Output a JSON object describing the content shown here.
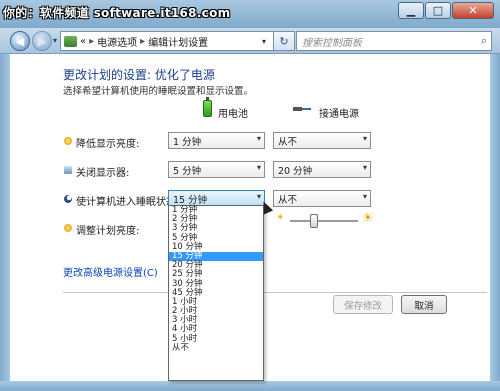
{
  "window": {
    "watermark": "你的：软件频道 software.it168.com",
    "minimize": "▁",
    "maximize": "□",
    "close": "✕"
  },
  "nav": {
    "back_glyph": "◀",
    "forward_glyph": "▶",
    "dropdown_glyph": "▾",
    "address_prefix": "«",
    "breadcrumb": [
      "电源选项",
      "编辑计划设置"
    ],
    "breadcrumb_sep": "▸",
    "refresh_glyph": "↻",
    "search_placeholder": "搜索控制面板",
    "search_glyph": "⌕"
  },
  "page": {
    "title": "更改计划的设置: 优化了电源",
    "subtitle": "选择希望计算机使用的睡眠设置和显示设置。",
    "columns": {
      "battery": "用电池",
      "plugged": "接通电源"
    },
    "rows": [
      {
        "label": "降低显示亮度:",
        "battery": "1 分钟",
        "plugged": "从不"
      },
      {
        "label": "关闭显示器:",
        "battery": "5 分钟",
        "plugged": "20 分钟"
      },
      {
        "label": "使计算机进入睡眠状态:",
        "battery": "15 分钟",
        "plugged": "从不"
      },
      {
        "label": "调整计划亮度:"
      }
    ],
    "brightness": {
      "battery_level": 0.5,
      "plugged_level": 0.35
    },
    "advanced_link": "更改高级电源设置(C)",
    "save_button": "保存修改",
    "cancel_button": "取消",
    "combo_arrow": "▾",
    "sun_glyph": "☀"
  },
  "dropdown": {
    "options": [
      "1 分钟",
      "2 分钟",
      "3 分钟",
      "5 分钟",
      "10 分钟",
      "15 分钟",
      "20 分钟",
      "25 分钟",
      "30 分钟",
      "45 分钟",
      "1 小时",
      "2 小时",
      "3 小时",
      "4 小时",
      "5 小时",
      "从不"
    ],
    "selected_index": 5
  },
  "colors": {
    "heading": "#1a3e8c",
    "link": "#0b47b8",
    "selection": "#3399ff"
  }
}
